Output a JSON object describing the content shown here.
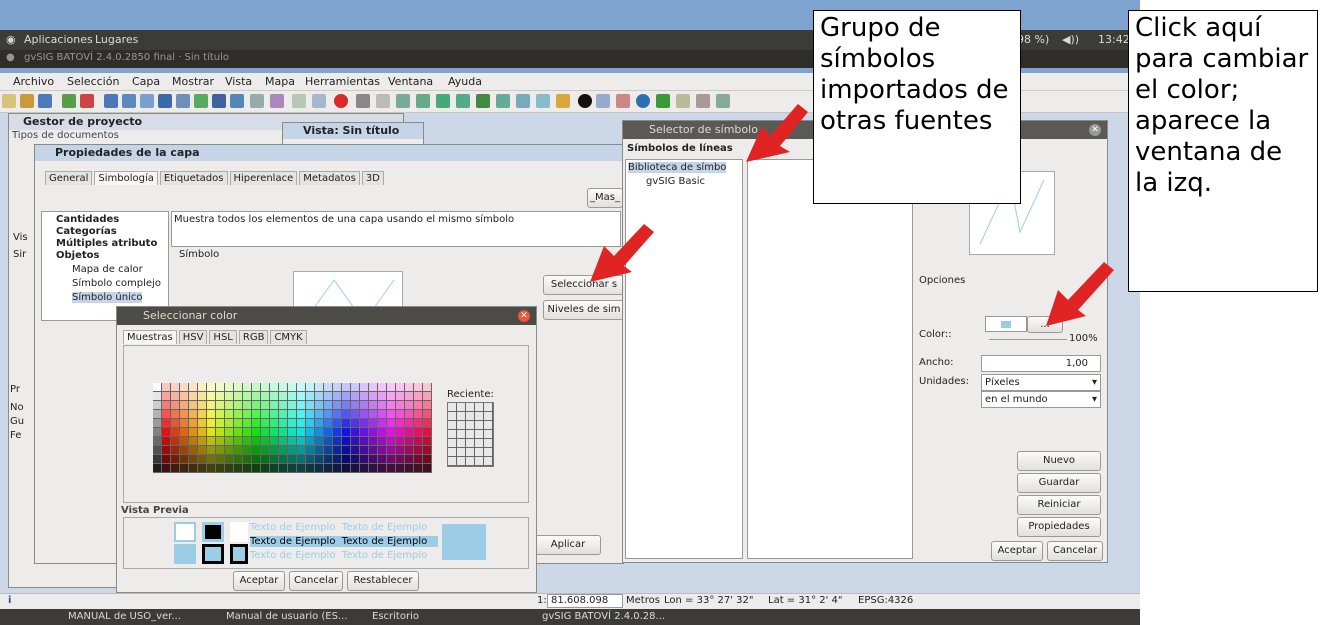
{
  "system_bar": {
    "apps": "Aplicaciones",
    "places": "Lugares",
    "battery": "98 %)",
    "time": "13:42"
  },
  "gvsig_title": "gvSIG BATOVÍ 2.4.0.2850 final · Sin título",
  "menu": [
    "Archivo",
    "Selección",
    "Capa",
    "Mostrar",
    "Vista",
    "Mapa",
    "Herramientas",
    "Ventana",
    "Ayuda"
  ],
  "project_manager": {
    "title": "Gestor de proyecto",
    "doc_types": "Tipos de documentos",
    "side_labels": [
      "Vis",
      "Sir",
      "Pr",
      "No",
      "Gu",
      "Fe"
    ]
  },
  "view_window": {
    "title": "Vista: Sin título"
  },
  "layer_props": {
    "title": "Propiedades de la capa",
    "tabs": [
      "General",
      "Simbología",
      "Etiquetados",
      "Hiperenlace",
      "Metadatos",
      "3D"
    ],
    "tree": [
      "Cantidades",
      "Categorías",
      "Múltiples atributo",
      "Objetos",
      "Mapa de calor",
      "Símbolo complejo",
      "Símbolo único"
    ],
    "description": "Muestra todos los elementos de una capa usando el mismo símbolo",
    "simbolo_label": "Símbolo",
    "select_button": "Seleccionar s",
    "levels_button": "Niveles de sim",
    "more_button": "_Mas_",
    "apply_button": "Aplicar"
  },
  "color_dialog": {
    "title": "Seleccionar color",
    "tabs": [
      "Muestras",
      "HSV",
      "HSL",
      "RGB",
      "CMYK"
    ],
    "recent_label": "Reciente:",
    "preview_label": "Vista Previa",
    "sample_text": "Texto de Ejemplo",
    "buttons": [
      "Aceptar",
      "Cancelar",
      "Restablecer"
    ]
  },
  "symbol_selector": {
    "title": "Selector de símbolo",
    "list_title": "Símbolos de líneas",
    "library": "Biblioteca de símbo",
    "basic": "gvSIG Basic",
    "options_label": "Opciones",
    "color_label": "Color::",
    "color_button": "...",
    "opacity": "100%",
    "width_label": "Ancho:",
    "width_value": "1,00",
    "units_label": "Unidades:",
    "units_value": "Píxeles",
    "world_value": "en el mundo",
    "side_buttons": [
      "Nuevo",
      "Guardar",
      "Reiniciar",
      "Propiedades"
    ],
    "accept": "Aceptar",
    "cancel": "Cancelar"
  },
  "status": {
    "scale": "81.608.098",
    "scale_prefix": "1:",
    "units": "Metros",
    "lon": "Lon = 33° 27' 32\"",
    "lat": "Lat = 31° 2' 4\"",
    "epsg": "EPSG:4326",
    "info": "i"
  },
  "taskbar": [
    "MANUAL de USO_ver...",
    "Manual de usuario (ES...",
    "Escritorio",
    "gvSIG BATOVÍ 2.4.0.28..."
  ],
  "callouts": {
    "left": "Grupo de símbolos importados de otras fuentes",
    "right": "Click aquí para cambiar el color; aparece la ventana de la izq."
  },
  "colors": {
    "accent_red": "#e02424",
    "swatch_selected": "#9ccde6"
  }
}
